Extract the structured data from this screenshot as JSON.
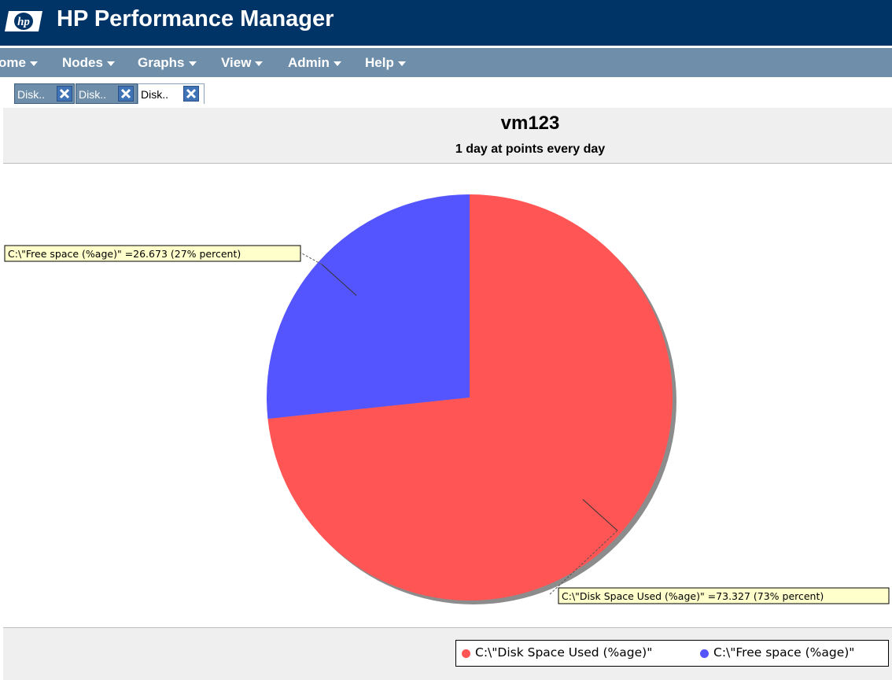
{
  "app": {
    "title": "HP Performance Manager",
    "logo_text": "hp"
  },
  "menu": {
    "items": [
      {
        "label": "ome"
      },
      {
        "label": "Nodes"
      },
      {
        "label": "Graphs"
      },
      {
        "label": "View"
      },
      {
        "label": "Admin"
      },
      {
        "label": "Help"
      }
    ]
  },
  "tabs": [
    {
      "label": "Disk..",
      "active": false
    },
    {
      "label": "Disk..",
      "active": false
    },
    {
      "label": "Disk..",
      "active": true
    }
  ],
  "graph": {
    "title": "vm123",
    "subtitle": "1 day at points every day"
  },
  "colors": {
    "title_bar": "#003366",
    "menu_bar": "#6f8eaa",
    "used_slice": "#ff5555",
    "free_slice": "#5555ff",
    "tooltip_bg": "#ffffcc"
  },
  "chart_data": {
    "type": "pie",
    "series": [
      {
        "name": "C:\\\"Disk Space Used (%age)\"",
        "value": 73.327,
        "color": "#ff5555",
        "label": "C:\\\"Disk Space Used (%age)\" =73.327 (73% percent)"
      },
      {
        "name": "C:\\\"Free space (%age)\"",
        "value": 26.673,
        "color": "#5555ff",
        "label": "C:\\\"Free space (%age)\" =26.673 (27% percent)"
      }
    ],
    "legend_position": "bottom-right"
  }
}
